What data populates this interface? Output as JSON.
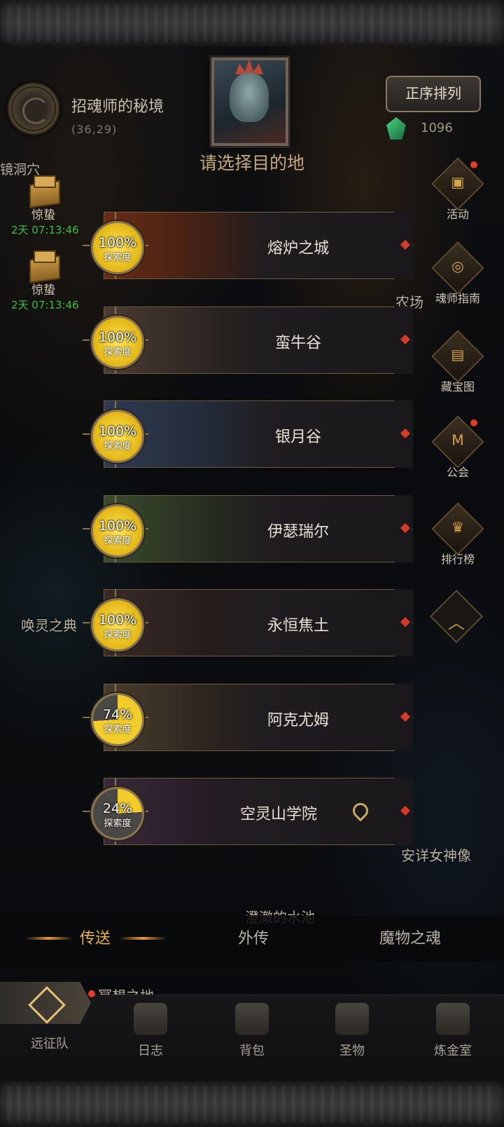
{
  "location": {
    "name": "招魂师的秘境",
    "coords": "(36,29)",
    "cave_label": "镜洞穴"
  },
  "header": {
    "title": "请选择目的地",
    "sort_button": "正序排列"
  },
  "currency": {
    "count": "1096",
    "icon": "green-gem-icon"
  },
  "left_items": [
    {
      "label": "惊蛰",
      "timer": "2天 07:13:46",
      "icon": "gift-box-icon"
    },
    {
      "label": "惊蛰",
      "timer": "2天 07:13:46",
      "icon": "gift-box-icon"
    }
  ],
  "right_menu": [
    {
      "label": "活动",
      "icon": "gift-icon",
      "badge": true
    },
    {
      "label": "魂师指南",
      "icon": "guide-icon",
      "badge": false
    },
    {
      "label": "藏宝图",
      "icon": "treasure-map-icon",
      "badge": false
    },
    {
      "label": "公会",
      "icon": "guild-icon",
      "badge": true
    },
    {
      "label": "排行榜",
      "icon": "trophy-icon",
      "badge": false
    }
  ],
  "map_labels": {
    "farm": "农场",
    "summon": "唤灵之典",
    "calm_pool": "澄澈的水池",
    "goddess": "安详女神像",
    "meditation": "冥想之地"
  },
  "destinations": [
    {
      "name": "熔炉之城",
      "percent": "100%",
      "percent_value": 100,
      "sub": "探索度",
      "current": false
    },
    {
      "name": "蛮牛谷",
      "percent": "100%",
      "percent_value": 100,
      "sub": "探索度",
      "current": false
    },
    {
      "name": "银月谷",
      "percent": "100%",
      "percent_value": 100,
      "sub": "探索度",
      "current": false
    },
    {
      "name": "伊瑟瑞尔",
      "percent": "100%",
      "percent_value": 100,
      "sub": "探索度",
      "current": false
    },
    {
      "name": "永恒焦土",
      "percent": "100%",
      "percent_value": 100,
      "sub": "探索度",
      "current": false
    },
    {
      "name": "阿克尤姆",
      "percent": "74%",
      "percent_value": 74,
      "sub": "探索度",
      "current": false
    },
    {
      "name": "空灵山学院",
      "percent": "24%",
      "percent_value": 24,
      "sub": "探索度",
      "current": true
    }
  ],
  "tabs": [
    {
      "label": "传送",
      "active": true
    },
    {
      "label": "外传",
      "active": false
    },
    {
      "label": "魔物之魂",
      "active": false
    }
  ],
  "bottom_nav": [
    {
      "label": "远征队",
      "icon": "expedition-icon"
    },
    {
      "label": "日志",
      "icon": "journal-icon"
    },
    {
      "label": "背包",
      "icon": "backpack-icon"
    },
    {
      "label": "圣物",
      "icon": "relic-icon"
    },
    {
      "label": "炼金室",
      "icon": "alchemy-icon"
    }
  ],
  "colors": {
    "accent": "#e7b24c",
    "badge": "#e23a2c",
    "timer": "#3fbf3f"
  }
}
